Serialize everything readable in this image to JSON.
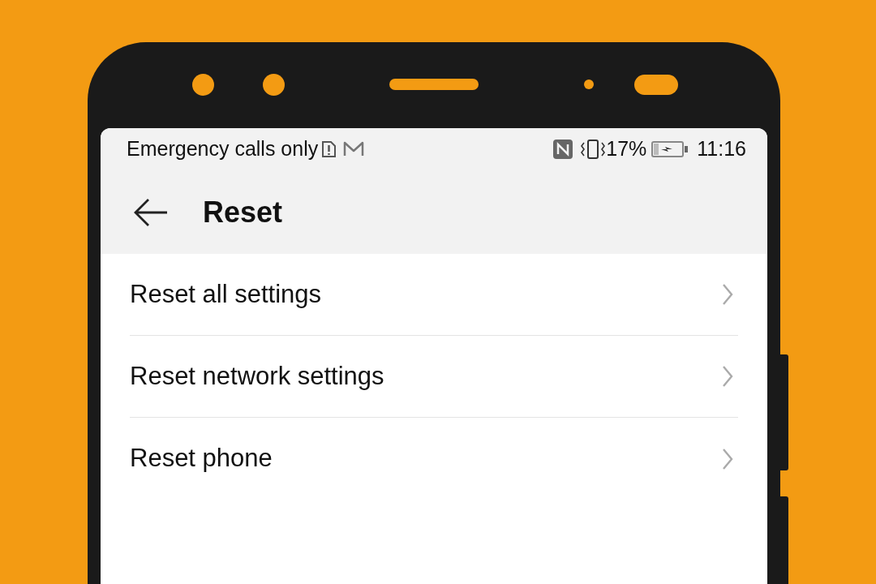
{
  "status_bar": {
    "carrier_text": "Emergency calls only",
    "battery_percent": "17%",
    "time": "11:16"
  },
  "app_bar": {
    "title": "Reset"
  },
  "items": [
    {
      "label": "Reset all settings"
    },
    {
      "label": "Reset network settings"
    },
    {
      "label": "Reset phone"
    }
  ]
}
